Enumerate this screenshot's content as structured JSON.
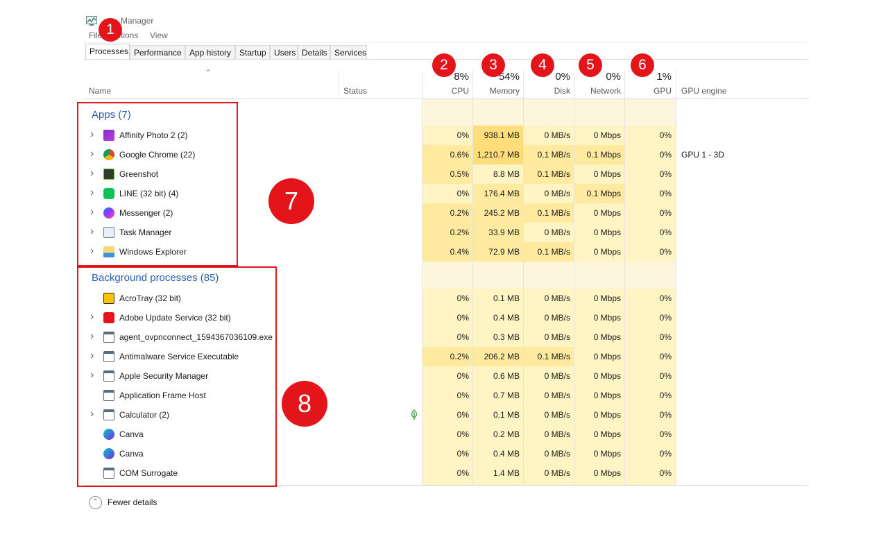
{
  "window": {
    "title": "Task Manager",
    "title_visible": "Manager"
  },
  "menu": [
    "File",
    "Options",
    "View"
  ],
  "tabs": [
    "Processes",
    "Performance",
    "App history",
    "Startup",
    "Users",
    "Details",
    "Services"
  ],
  "active_tab": "Processes",
  "columns": {
    "name": "Name",
    "status": "Status",
    "cpu": {
      "label": "CPU",
      "pct": "8%"
    },
    "memory": {
      "label": "Memory",
      "pct": "54%"
    },
    "disk": {
      "label": "Disk",
      "pct": "0%"
    },
    "network": {
      "label": "Network",
      "pct": "0%"
    },
    "gpu": {
      "label": "GPU",
      "pct": "1%"
    },
    "gpu_engine": "GPU engine"
  },
  "groups": {
    "apps": {
      "title": "Apps (7)",
      "rows": [
        {
          "name": "Affinity Photo 2 (2)",
          "icon": "affinity-photo-icon",
          "expandable": true,
          "cpu": "0%",
          "memory": "938.1 MB",
          "disk": "0 MB/s",
          "network": "0 Mbps",
          "gpu": "0%",
          "gpu_engine": ""
        },
        {
          "name": "Google Chrome (22)",
          "icon": "chrome-icon",
          "expandable": true,
          "cpu": "0.6%",
          "memory": "1,210.7 MB",
          "disk": "0.1 MB/s",
          "network": "0.1 Mbps",
          "gpu": "0%",
          "gpu_engine": "GPU 1 - 3D"
        },
        {
          "name": "Greenshot",
          "icon": "greenshot-icon",
          "expandable": true,
          "cpu": "0.5%",
          "memory": "8.8 MB",
          "disk": "0.1 MB/s",
          "network": "0 Mbps",
          "gpu": "0%",
          "gpu_engine": ""
        },
        {
          "name": "LINE (32 bit) (4)",
          "icon": "line-icon",
          "expandable": true,
          "cpu": "0%",
          "memory": "176.4 MB",
          "disk": "0 MB/s",
          "network": "0.1 Mbps",
          "gpu": "0%",
          "gpu_engine": ""
        },
        {
          "name": "Messenger (2)",
          "icon": "messenger-icon",
          "expandable": true,
          "cpu": "0.2%",
          "memory": "245.2 MB",
          "disk": "0.1 MB/s",
          "network": "0 Mbps",
          "gpu": "0%",
          "gpu_engine": ""
        },
        {
          "name": "Task Manager",
          "icon": "task-manager-icon",
          "expandable": true,
          "cpu": "0.2%",
          "memory": "33.9 MB",
          "disk": "0 MB/s",
          "network": "0 Mbps",
          "gpu": "0%",
          "gpu_engine": ""
        },
        {
          "name": "Windows Explorer",
          "icon": "folder-icon",
          "expandable": true,
          "cpu": "0.4%",
          "memory": "72.9 MB",
          "disk": "0.1 MB/s",
          "network": "0 Mbps",
          "gpu": "0%",
          "gpu_engine": ""
        }
      ]
    },
    "background": {
      "title": "Background processes (85)",
      "rows": [
        {
          "name": "AcroTray (32 bit)",
          "icon": "acrotray-icon",
          "expandable": false,
          "cpu": "0%",
          "memory": "0.1 MB",
          "disk": "0 MB/s",
          "network": "0 Mbps",
          "gpu": "0%"
        },
        {
          "name": "Adobe Update Service (32 bit)",
          "icon": "adobe-icon",
          "expandable": true,
          "cpu": "0%",
          "memory": "0.4 MB",
          "disk": "0 MB/s",
          "network": "0 Mbps",
          "gpu": "0%"
        },
        {
          "name": "agent_ovpnconnect_1594367036109.exe",
          "icon": "app-window-icon",
          "expandable": true,
          "cpu": "0%",
          "memory": "0.3 MB",
          "disk": "0 MB/s",
          "network": "0 Mbps",
          "gpu": "0%"
        },
        {
          "name": "Antimalware Service Executable",
          "icon": "app-window-icon",
          "expandable": true,
          "cpu": "0.2%",
          "memory": "206.2 MB",
          "disk": "0.1 MB/s",
          "network": "0 Mbps",
          "gpu": "0%"
        },
        {
          "name": "Apple Security Manager",
          "icon": "app-window-icon",
          "expandable": true,
          "cpu": "0%",
          "memory": "0.6 MB",
          "disk": "0 MB/s",
          "network": "0 Mbps",
          "gpu": "0%"
        },
        {
          "name": "Application Frame Host",
          "icon": "app-window-icon",
          "expandable": false,
          "cpu": "0%",
          "memory": "0.7 MB",
          "disk": "0 MB/s",
          "network": "0 Mbps",
          "gpu": "0%"
        },
        {
          "name": "Calculator (2)",
          "icon": "app-window-icon",
          "expandable": true,
          "cpu": "0%",
          "memory": "0.1 MB",
          "disk": "0 MB/s",
          "network": "0 Mbps",
          "gpu": "0%",
          "status_icon": "leaf-icon"
        },
        {
          "name": "Canva",
          "icon": "canva-icon",
          "expandable": false,
          "cpu": "0%",
          "memory": "0.2 MB",
          "disk": "0 MB/s",
          "network": "0 Mbps",
          "gpu": "0%"
        },
        {
          "name": "Canva",
          "icon": "canva-icon",
          "expandable": false,
          "cpu": "0%",
          "memory": "0.4 MB",
          "disk": "0 MB/s",
          "network": "0 Mbps",
          "gpu": "0%"
        },
        {
          "name": "COM Surrogate",
          "icon": "app-window-icon",
          "expandable": false,
          "cpu": "0%",
          "memory": "1.4 MB",
          "disk": "0 MB/s",
          "network": "0 Mbps",
          "gpu": "0%"
        }
      ]
    }
  },
  "footer": {
    "fewer_details": "Fewer details"
  },
  "annotations": [
    "1",
    "2",
    "3",
    "4",
    "5",
    "6",
    "7",
    "8"
  ],
  "colors": {
    "group_title": "#2b5fad",
    "annotation_red": "#e3141a",
    "heat_light": "#fff4c4",
    "heat_mid": "#ffeaa0",
    "heat_strong": "#ffdd7a"
  }
}
